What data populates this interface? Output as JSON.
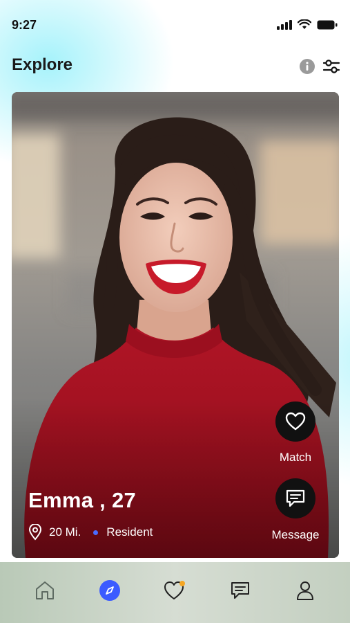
{
  "status_bar": {
    "time": "9:27"
  },
  "header": {
    "title": "Explore"
  },
  "profile": {
    "name": "Emma , 27",
    "distance": "20 Mi.",
    "status": "Resident"
  },
  "actions": {
    "match_label": "Match",
    "message_label": "Message"
  },
  "nav": {
    "items": [
      {
        "icon": "home-icon"
      },
      {
        "icon": "compass-icon",
        "active": true
      },
      {
        "icon": "heart-icon",
        "badge": true
      },
      {
        "icon": "chat-icon"
      },
      {
        "icon": "profile-icon"
      }
    ]
  },
  "colors": {
    "accent": "#3b5bff",
    "status_dot": "#4a6cff",
    "badge": "#f5a623",
    "shirt": "#a4121f"
  }
}
